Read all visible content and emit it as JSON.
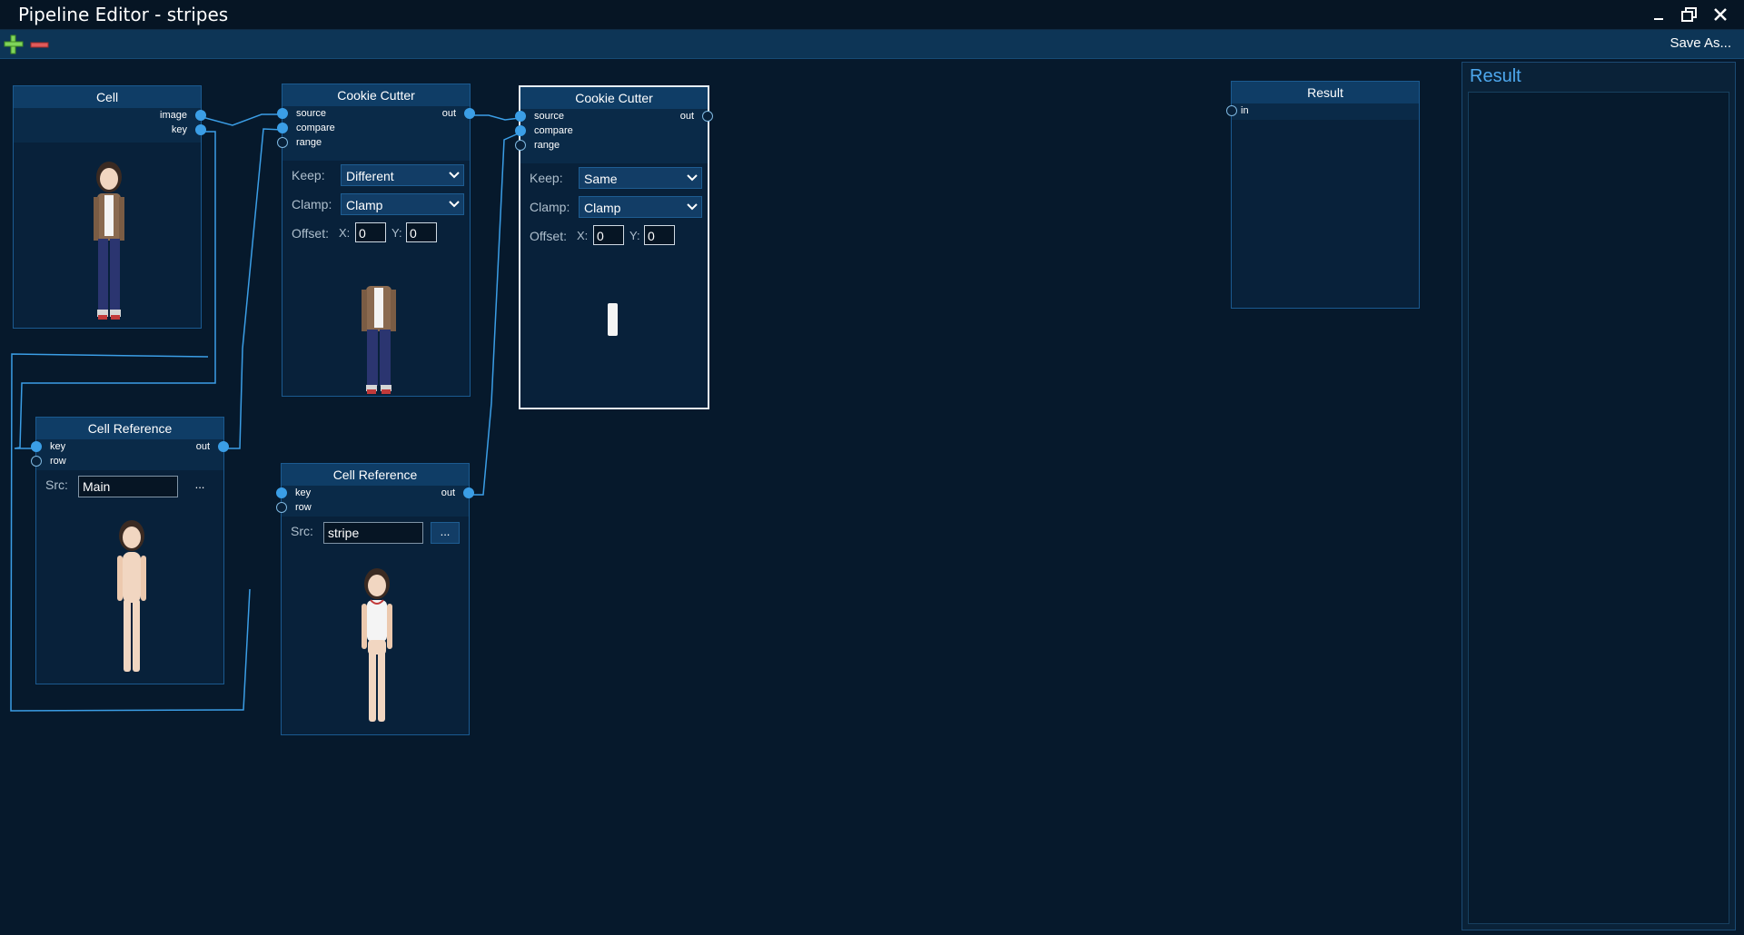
{
  "window": {
    "title": "Pipeline Editor - stripes",
    "controls": [
      "minimize",
      "restore",
      "close"
    ]
  },
  "toolbar": {
    "add_icon": "plus-icon",
    "remove_icon": "minus-icon",
    "save_as_label": "Save As..."
  },
  "colors": {
    "background": "#06192c",
    "node_header": "#0f3d66",
    "wire": "#3b9ee6",
    "accent_green": "#7fd45a",
    "accent_red": "#e05a5a"
  },
  "nodes": {
    "cell": {
      "title": "Cell",
      "outputs": [
        "image",
        "key"
      ],
      "preview": "character-full-outfit"
    },
    "cookie1": {
      "title": "Cookie Cutter",
      "inputs": [
        "source",
        "compare",
        "range"
      ],
      "output": "out",
      "keep_label": "Keep:",
      "keep_value": "Different",
      "clamp_label": "Clamp:",
      "clamp_value": "Clamp",
      "offset_label": "Offset:",
      "x_label": "X:",
      "x_value": "0",
      "y_label": "Y:",
      "y_value": "0",
      "preview": "clothing-only"
    },
    "cookie2": {
      "title": "Cookie Cutter",
      "inputs": [
        "source",
        "compare",
        "range"
      ],
      "output": "out",
      "keep_label": "Keep:",
      "keep_value": "Same",
      "clamp_label": "Clamp:",
      "clamp_value": "Clamp",
      "offset_label": "Offset:",
      "x_label": "X:",
      "x_value": "0",
      "y_label": "Y:",
      "y_value": "0",
      "preview": "white-stripe"
    },
    "cellref1": {
      "title": "Cell Reference",
      "inputs": [
        "key",
        "row"
      ],
      "output": "out",
      "src_label": "Src:",
      "src_value": "Main",
      "browse_label": "...",
      "preview": "character-base"
    },
    "cellref2": {
      "title": "Cell Reference",
      "inputs": [
        "key",
        "row"
      ],
      "output": "out",
      "src_label": "Src:",
      "src_value": "stripe",
      "browse_label": "...",
      "preview": "character-tanktop"
    },
    "result": {
      "title": "Result",
      "inputs": [
        "in"
      ]
    }
  },
  "result_panel": {
    "title": "Result"
  }
}
